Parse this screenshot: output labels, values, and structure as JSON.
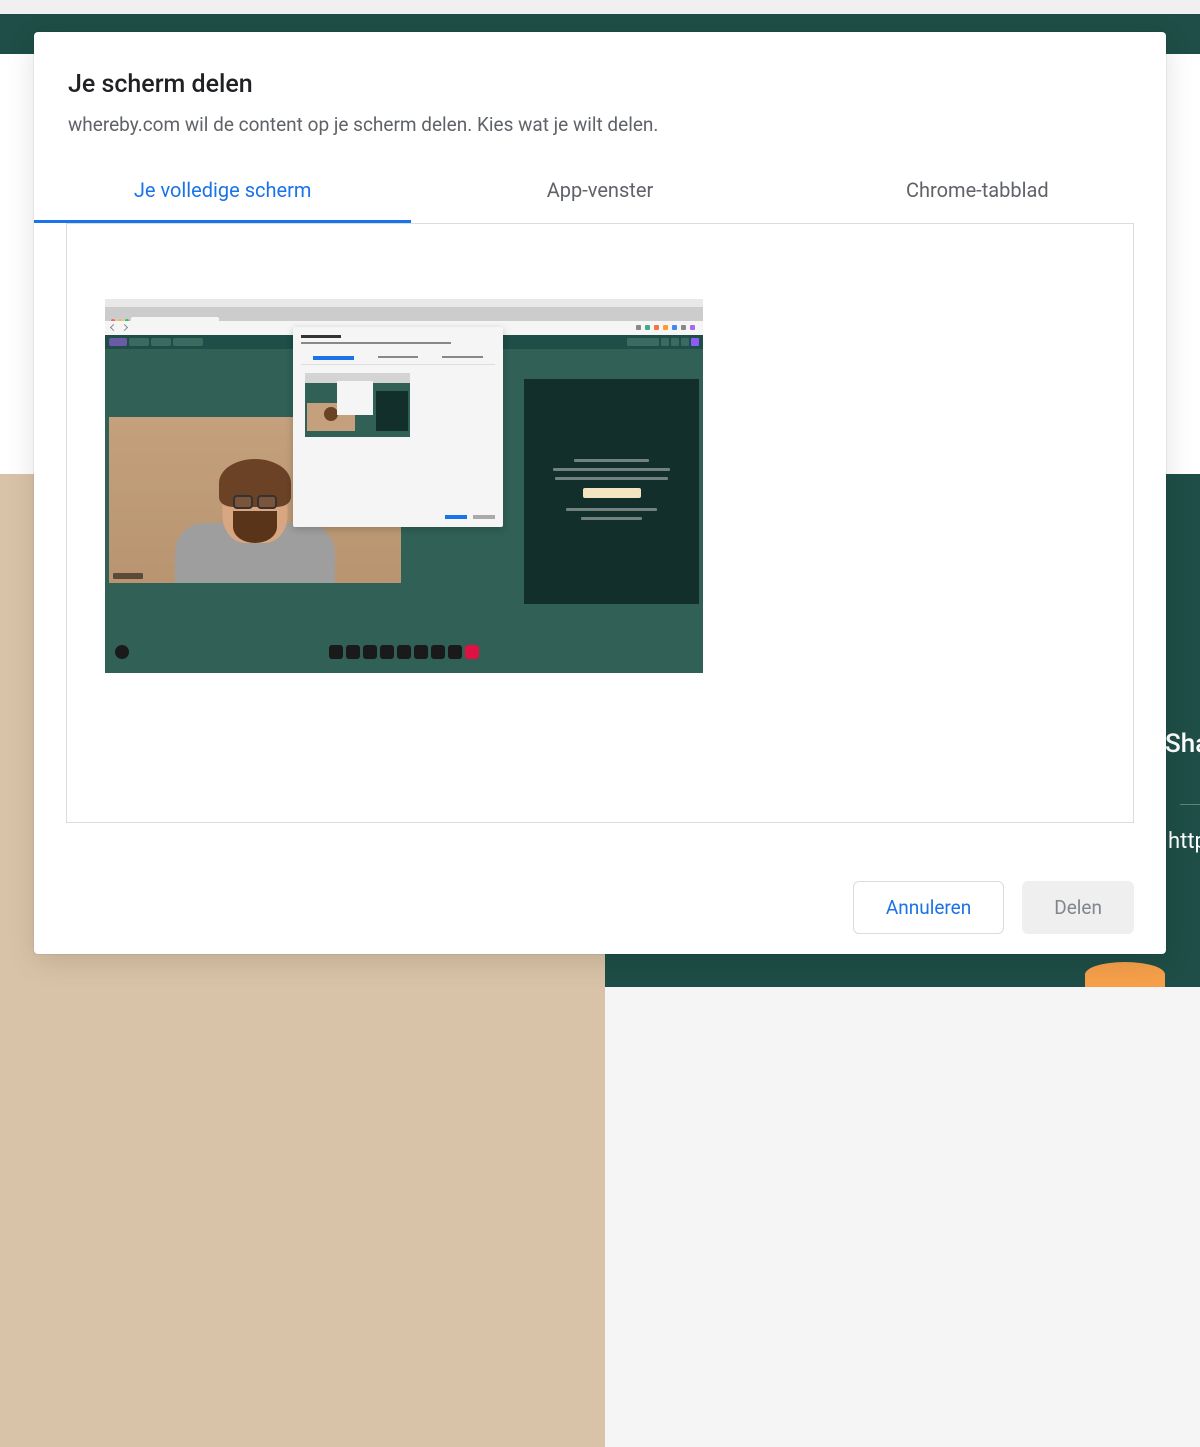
{
  "modal": {
    "title": "Je scherm delen",
    "subtitle": "whereby.com wil de content op je scherm delen. Kies wat je wilt delen.",
    "tabs": [
      {
        "label": "Je volledige scherm",
        "active": true
      },
      {
        "label": "App-venster",
        "active": false
      },
      {
        "label": "Chrome-tabblad",
        "active": false
      }
    ],
    "buttons": {
      "cancel": "Annuleren",
      "share": "Delen"
    }
  },
  "background_peek": {
    "text1": "Sha",
    "text2": "http"
  }
}
